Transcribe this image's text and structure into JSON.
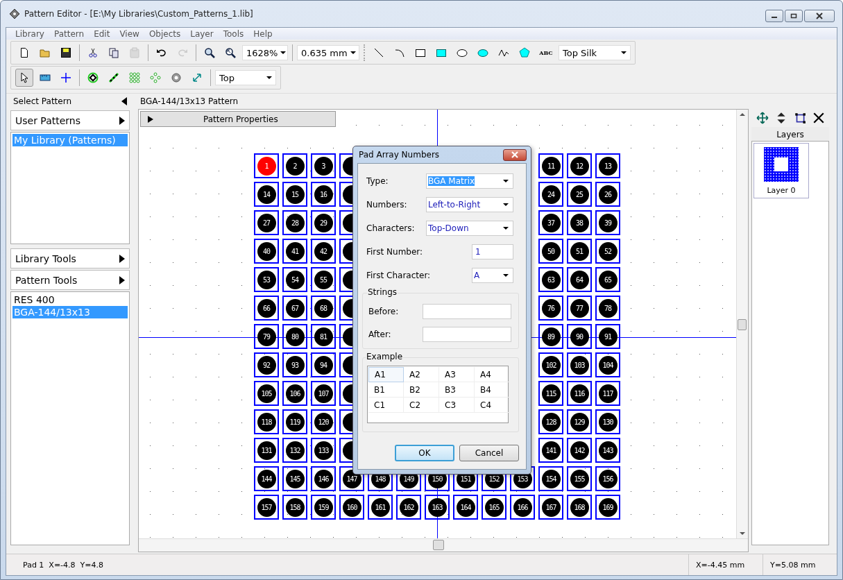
{
  "window": {
    "title": "Pattern Editor - [E:\\My Libraries\\Custom_Patterns_1.lib]"
  },
  "menu": [
    "Library",
    "Pattern",
    "Edit",
    "View",
    "Objects",
    "Layer",
    "Tools",
    "Help"
  ],
  "toolbar": {
    "zoom": "1628%",
    "grid": "0.635 mm",
    "draw_layer": "Top Silk",
    "text_tool": "ABC",
    "paste_disabled": true,
    "redo_disabled": true,
    "select_pressed": true,
    "pad_layer": "Top"
  },
  "left_panel": {
    "header": "Select Pattern",
    "sections": [
      {
        "kind": "header",
        "label": "User Patterns"
      },
      {
        "kind": "list",
        "items": [
          {
            "label": "My Library (Patterns)",
            "selected": true
          }
        ]
      },
      {
        "kind": "header",
        "label": "Library Tools"
      },
      {
        "kind": "header",
        "label": "Pattern Tools"
      },
      {
        "kind": "list",
        "items": [
          {
            "label": "RES 400",
            "selected": false
          },
          {
            "label": "BGA-144/13x13",
            "selected": true
          }
        ]
      }
    ]
  },
  "canvas": {
    "title": "BGA-144/13x13 Pattern",
    "properties_bar": "Pattern Properties",
    "pad_rows": [
      [
        {
          "label": "1",
          "selected": true
        },
        {
          "label": "2",
          "selected": false
        },
        {
          "label": "3",
          "selected": false
        },
        {
          "selected": false
        },
        null,
        null,
        null,
        null,
        null,
        null,
        {
          "label": "11",
          "selected": false
        },
        {
          "label": "12",
          "selected": false
        },
        {
          "label": "13",
          "selected": false
        }
      ],
      [
        {
          "label": "14",
          "selected": false
        },
        {
          "label": "15",
          "selected": false
        },
        {
          "label": "16",
          "selected": false
        },
        {
          "selected": false
        },
        null,
        null,
        null,
        null,
        null,
        null,
        {
          "label": "24",
          "selected": false
        },
        {
          "label": "25",
          "selected": false
        },
        {
          "label": "26",
          "selected": false
        }
      ],
      [
        {
          "label": "27",
          "selected": false
        },
        {
          "label": "28",
          "selected": false
        },
        {
          "label": "29",
          "selected": false
        },
        {
          "selected": false
        },
        null,
        null,
        null,
        null,
        null,
        null,
        {
          "label": "37",
          "selected": false
        },
        {
          "label": "38",
          "selected": false
        },
        {
          "label": "39",
          "selected": false
        }
      ],
      [
        {
          "label": "40",
          "selected": false
        },
        {
          "label": "41",
          "selected": false
        },
        {
          "label": "42",
          "selected": false
        },
        {
          "selected": false
        },
        null,
        null,
        null,
        null,
        null,
        null,
        {
          "label": "50",
          "selected": false
        },
        {
          "label": "51",
          "selected": false
        },
        {
          "label": "52",
          "selected": false
        }
      ],
      [
        {
          "label": "53",
          "selected": false
        },
        {
          "label": "54",
          "selected": false
        },
        {
          "label": "55",
          "selected": false
        },
        {
          "selected": false
        },
        null,
        null,
        null,
        null,
        null,
        null,
        {
          "label": "63",
          "selected": false
        },
        {
          "label": "64",
          "selected": false
        },
        {
          "label": "65",
          "selected": false
        }
      ],
      [
        {
          "label": "66",
          "selected": false
        },
        {
          "label": "67",
          "selected": false
        },
        {
          "label": "68",
          "selected": false
        },
        {
          "selected": false
        },
        null,
        null,
        null,
        null,
        null,
        null,
        {
          "label": "76",
          "selected": false
        },
        {
          "label": "77",
          "selected": false
        },
        {
          "label": "78",
          "selected": false
        }
      ],
      [
        {
          "label": "79",
          "selected": false
        },
        {
          "label": "80",
          "selected": false
        },
        {
          "label": "81",
          "selected": false
        },
        {
          "selected": false
        },
        null,
        null,
        null,
        null,
        null,
        null,
        {
          "label": "89",
          "selected": false
        },
        {
          "label": "90",
          "selected": false
        },
        {
          "label": "91",
          "selected": false
        }
      ],
      [
        {
          "label": "92",
          "selected": false
        },
        {
          "label": "93",
          "selected": false
        },
        {
          "label": "94",
          "selected": false
        },
        {
          "selected": false
        },
        null,
        null,
        null,
        null,
        null,
        null,
        {
          "label": "102",
          "selected": false
        },
        {
          "label": "103",
          "selected": false
        },
        {
          "label": "104",
          "selected": false
        }
      ],
      [
        {
          "label": "105",
          "selected": false
        },
        {
          "label": "106",
          "selected": false
        },
        {
          "label": "107",
          "selected": false
        },
        {
          "selected": false
        },
        null,
        null,
        null,
        null,
        null,
        null,
        {
          "label": "115",
          "selected": false
        },
        {
          "label": "116",
          "selected": false
        },
        {
          "label": "117",
          "selected": false
        }
      ],
      [
        {
          "label": "118",
          "selected": false
        },
        {
          "label": "119",
          "selected": false
        },
        {
          "label": "120",
          "selected": false
        },
        {
          "selected": false
        },
        null,
        null,
        null,
        null,
        null,
        null,
        {
          "label": "128",
          "selected": false
        },
        {
          "label": "129",
          "selected": false
        },
        {
          "label": "130",
          "selected": false
        }
      ],
      [
        {
          "label": "131",
          "selected": false
        },
        {
          "label": "132",
          "selected": false
        },
        {
          "label": "133",
          "selected": false
        },
        {
          "selected": false
        },
        null,
        null,
        null,
        null,
        null,
        null,
        {
          "label": "141",
          "selected": false
        },
        {
          "label": "142",
          "selected": false
        },
        {
          "label": "143",
          "selected": false
        }
      ],
      [
        {
          "label": "144",
          "selected": false
        },
        {
          "label": "145",
          "selected": false
        },
        {
          "label": "146",
          "selected": false
        },
        {
          "label": "147",
          "selected": false
        },
        {
          "label": "148",
          "selected": false
        },
        {
          "label": "149",
          "selected": false
        },
        {
          "label": "150",
          "selected": false
        },
        {
          "label": "151",
          "selected": false
        },
        {
          "label": "152",
          "selected": false
        },
        {
          "label": "153",
          "selected": false
        },
        {
          "label": "154",
          "selected": false
        },
        {
          "label": "155",
          "selected": false
        },
        {
          "label": "156",
          "selected": false
        }
      ],
      [
        {
          "label": "157",
          "selected": false
        },
        {
          "label": "158",
          "selected": false
        },
        {
          "label": "159",
          "selected": false
        },
        {
          "label": "160",
          "selected": false
        },
        {
          "label": "161",
          "selected": false
        },
        {
          "label": "162",
          "selected": false
        },
        {
          "label": "163",
          "selected": false
        },
        {
          "label": "164",
          "selected": false
        },
        {
          "label": "165",
          "selected": false
        },
        {
          "label": "166",
          "selected": false
        },
        {
          "label": "167",
          "selected": false
        },
        {
          "label": "168",
          "selected": false
        },
        {
          "label": "169",
          "selected": false
        }
      ]
    ]
  },
  "dialog": {
    "title": "Pad Array Numbers",
    "fields": [
      {
        "kind": "combo",
        "label": "Type:",
        "value": "BGA Matrix",
        "highlighted": true
      },
      {
        "kind": "combo",
        "label": "Numbers:",
        "value": "Left-to-Right",
        "highlighted": false
      },
      {
        "kind": "combo",
        "label": "Characters:",
        "value": "Top-Down",
        "highlighted": false
      },
      {
        "kind": "input",
        "label": "First Number:",
        "value": "1"
      },
      {
        "kind": "small_combo",
        "label": "First Character:",
        "value": "A"
      }
    ],
    "strings": {
      "title": "Strings",
      "fields": [
        {
          "label": "Before:"
        },
        {
          "label": "After:"
        }
      ]
    },
    "example": {
      "title": "Example",
      "rows": [
        [
          "A1",
          "A2",
          "A3",
          "A4"
        ],
        [
          "B1",
          "B2",
          "B3",
          "B4"
        ],
        [
          "C1",
          "C2",
          "C3",
          "C4"
        ]
      ]
    },
    "buttons": [
      {
        "label": "OK",
        "default": true
      },
      {
        "label": "Cancel",
        "default": false
      }
    ]
  },
  "layers": {
    "title": "Layers",
    "items": [
      {
        "label": "Layer 0"
      }
    ]
  },
  "status_bar": {
    "pad": "Pad 1  X=-4.8  Y=4.8",
    "x": "X=-4.45 mm",
    "y": "Y=5.08 mm"
  }
}
